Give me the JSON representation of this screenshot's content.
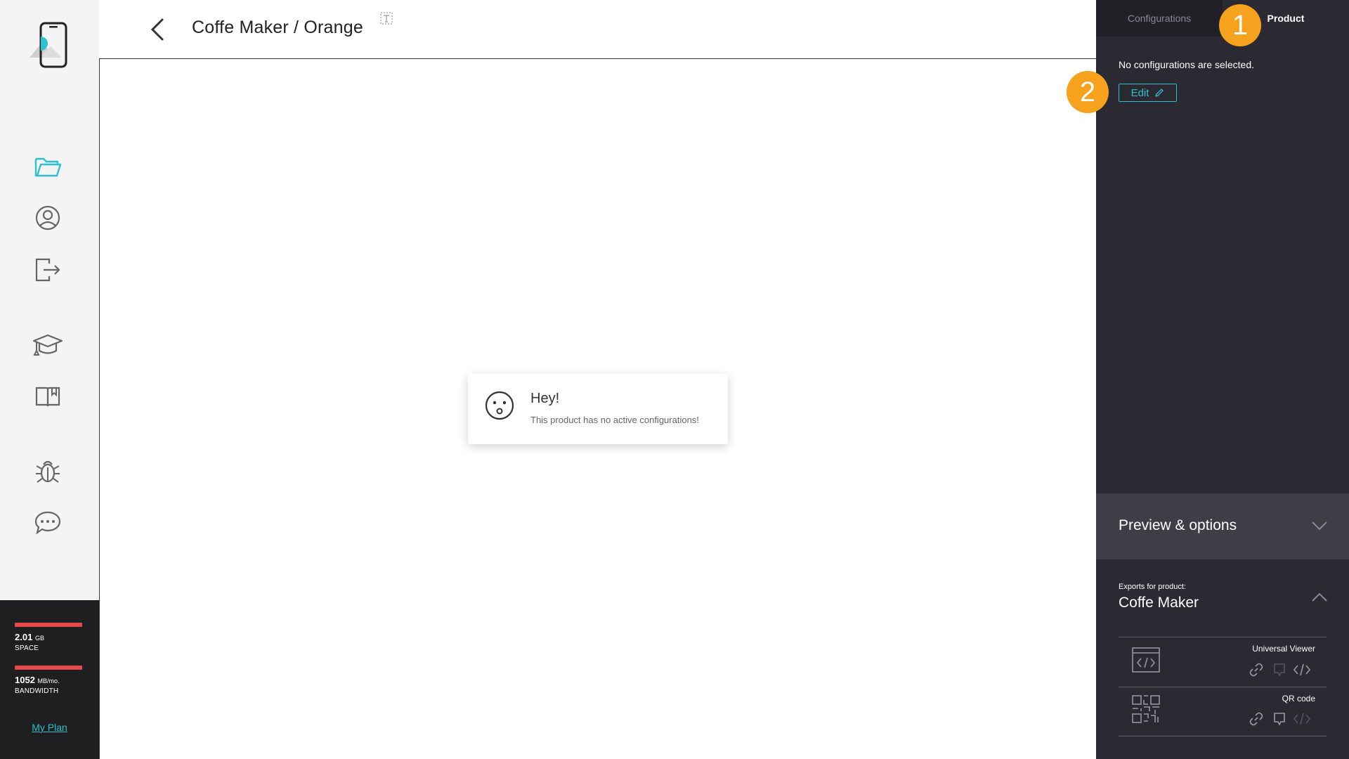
{
  "sidebar": {
    "nav": [
      {
        "name": "folder-icon",
        "active": true
      },
      {
        "name": "user-icon"
      },
      {
        "name": "logout-icon"
      },
      {
        "name": "graduation-cap-icon"
      },
      {
        "name": "book-icon"
      },
      {
        "name": "bug-icon"
      },
      {
        "name": "chat-icon"
      }
    ],
    "usage": {
      "space_value": "2.01",
      "space_unit": "GB",
      "space_label": "SPACE",
      "bandwidth_value": "1052",
      "bandwidth_unit": "MB/mo.",
      "bandwidth_label": "BANDWIDTH",
      "my_plan": "My Plan"
    }
  },
  "header": {
    "title": "Coffe Maker / Orange"
  },
  "toast": {
    "title": "Hey!",
    "message": "This product has no active configurations!"
  },
  "panel": {
    "tabs": {
      "configurations": "Configurations",
      "product": "Product"
    },
    "no_config_text": "No configurations are selected.",
    "edit_label": "Edit",
    "preview_title": "Preview & options",
    "exports_caption": "Exports for product:",
    "exports_product": "Coffe Maker",
    "exports": [
      {
        "label": "Universal Viewer"
      },
      {
        "label": "QR code"
      }
    ]
  },
  "markers": {
    "one": "1",
    "two": "2"
  },
  "colors": {
    "accent": "#2ec0cf",
    "marker": "#f6a21c",
    "panel_bg": "#2b2a33",
    "usage_bar": "#e8474c"
  }
}
